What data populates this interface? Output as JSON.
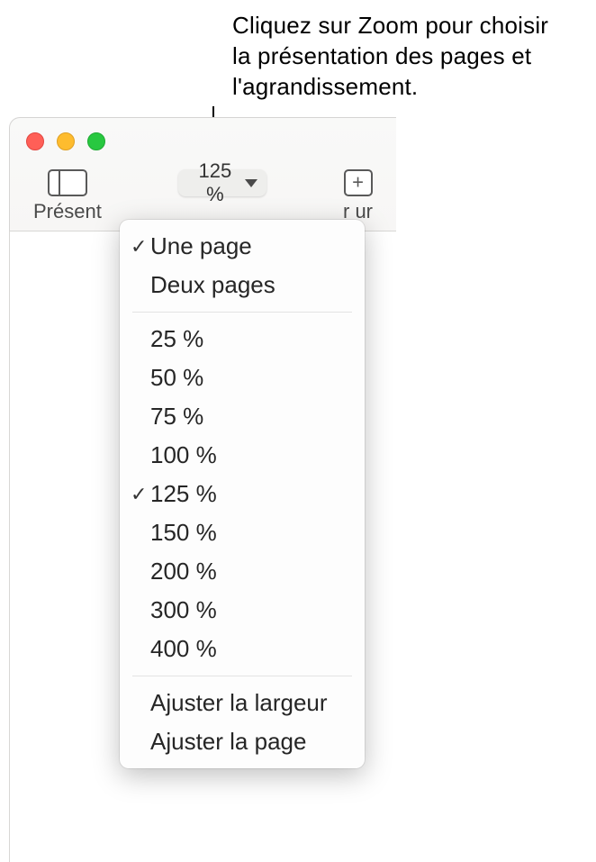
{
  "annotation": {
    "line1": "Cliquez sur Zoom pour choisir",
    "line2": "la présentation des pages et",
    "line3": "l'agrandissement."
  },
  "toolbar": {
    "view": {
      "label": "Présent"
    },
    "zoom": {
      "label": "125 %"
    },
    "add": {
      "label": "r ur"
    }
  },
  "menu": {
    "page_section": [
      {
        "label": "Une page",
        "checked": true
      },
      {
        "label": "Deux pages",
        "checked": false
      }
    ],
    "zoom_levels": [
      {
        "label": "25 %",
        "checked": false
      },
      {
        "label": "50 %",
        "checked": false
      },
      {
        "label": "75 %",
        "checked": false
      },
      {
        "label": "100 %",
        "checked": false
      },
      {
        "label": "125 %",
        "checked": true
      },
      {
        "label": "150 %",
        "checked": false
      },
      {
        "label": "200 %",
        "checked": false
      },
      {
        "label": "300 %",
        "checked": false
      },
      {
        "label": "400 %",
        "checked": false
      }
    ],
    "fit_section": [
      {
        "label": "Ajuster la largeur",
        "checked": false
      },
      {
        "label": "Ajuster la page",
        "checked": false
      }
    ]
  }
}
